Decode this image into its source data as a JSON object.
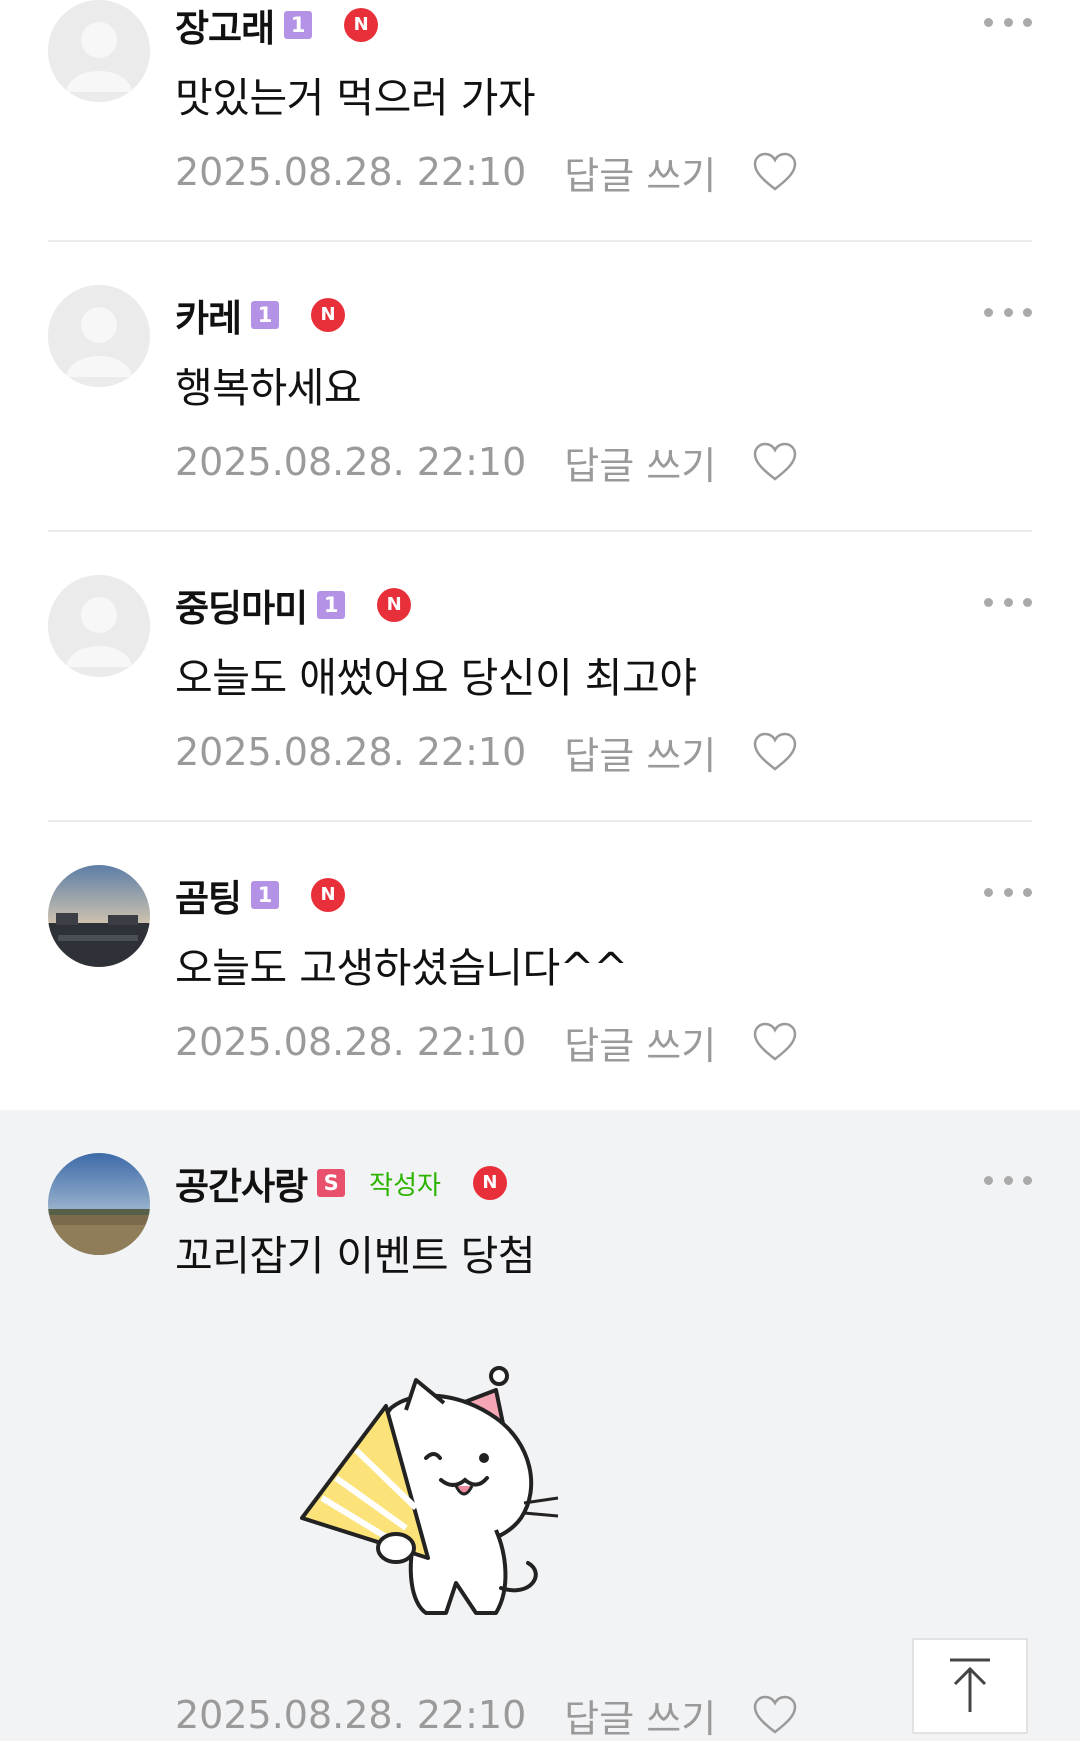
{
  "comments": [
    {
      "nickname": "장고래",
      "level": "1",
      "new_badge": "N",
      "text": "맛있는거 먹으러 가자",
      "time": "2025.08.28. 22:10",
      "reply_label": "답글 쓰기",
      "avatar": "default-avatar-icon"
    },
    {
      "nickname": "카레",
      "level": "1",
      "new_badge": "N",
      "text": "행복하세요",
      "time": "2025.08.28. 22:10",
      "reply_label": "답글 쓰기",
      "avatar": "default-avatar-icon"
    },
    {
      "nickname": "중딩마미",
      "level": "1",
      "new_badge": "N",
      "text": "오늘도 애썼어요 당신이 최고야",
      "time": "2025.08.28. 22:10",
      "reply_label": "답글 쓰기",
      "avatar": "default-avatar-icon"
    },
    {
      "nickname": "곰팅",
      "level": "1",
      "new_badge": "N",
      "text": "오늘도 고생하셨습니다^^",
      "time": "2025.08.28. 22:10",
      "reply_label": "답글 쓰기",
      "avatar": "sunset-photo-avatar"
    },
    {
      "nickname": "공간사랑",
      "level": "S",
      "author_tag": "작성자",
      "new_badge": "N",
      "text": "꼬리잡기 이벤트 당첨",
      "time": "2025.08.28. 22:10",
      "reply_label": "답글 쓰기",
      "avatar": "field-photo-avatar",
      "sticker": "party-cat-sticker"
    }
  ],
  "colors": {
    "author_bg": "#f2f3f5",
    "level_badge": "#b493e6",
    "staff_badge": "#e8506c",
    "author_tag": "#2db400",
    "new_badge": "#e8303a",
    "meta_text": "#9a9a9a"
  },
  "icons": {
    "more": "more-dots-icon",
    "like": "heart-outline-icon",
    "scroll_top": "arrow-up-to-top-icon"
  }
}
